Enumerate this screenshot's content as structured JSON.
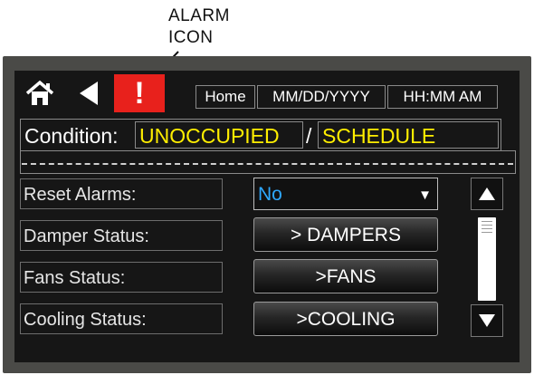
{
  "callout": {
    "line1": "ALARM",
    "line2": "ICON"
  },
  "toolbar": {
    "home_icon": "home-icon",
    "back_icon": "back-arrow-icon",
    "alarm_icon": "alarm-exclamation-icon",
    "alarm_glyph": "!",
    "alarm_color": "#e8211c",
    "home_label": "Home",
    "date_label": "MM/DD/YYYY",
    "time_label": "HH:MM AM"
  },
  "condition": {
    "label": "Condition:",
    "occupancy": "UNOCCUPIED",
    "separator": "/",
    "mode": "SCHEDULE",
    "value_color": "#ffee00"
  },
  "rows": [
    {
      "label": "Reset Alarms:",
      "control": "dropdown",
      "value": "No"
    },
    {
      "label": "Damper Status:",
      "control": "button",
      "value": "> DAMPERS"
    },
    {
      "label": "Fans Status:",
      "control": "button",
      "value": ">FANS"
    },
    {
      "label": "Cooling Status:",
      "control": "button",
      "value": ">COOLING"
    }
  ],
  "scrollbar": {
    "up_icon": "triangle-up-icon",
    "down_icon": "triangle-down-icon"
  }
}
